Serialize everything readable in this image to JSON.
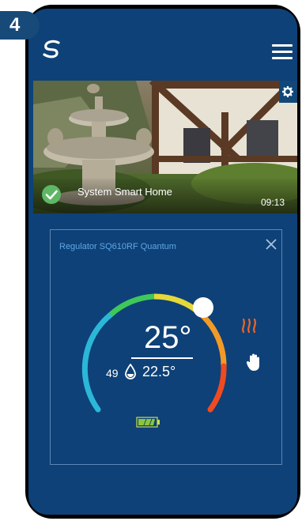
{
  "step": {
    "number": "4"
  },
  "header": {
    "logo": "salus-logo-icon",
    "menu": "hamburger-menu-icon"
  },
  "system": {
    "name": "System Smart Home",
    "time": "09:13",
    "status": "online"
  },
  "thermostat": {
    "title": "Regulator SQ610RF Quantum",
    "current_temp": "25°",
    "humidity": "49",
    "set_temp": "22.5°",
    "mode": "manual",
    "heating": "on",
    "battery": "full"
  },
  "colors": {
    "screen": "#0e4177",
    "badge": "#174a79",
    "check": "#5fb766",
    "accent": "#f26522",
    "title": "#5fa7e6"
  }
}
